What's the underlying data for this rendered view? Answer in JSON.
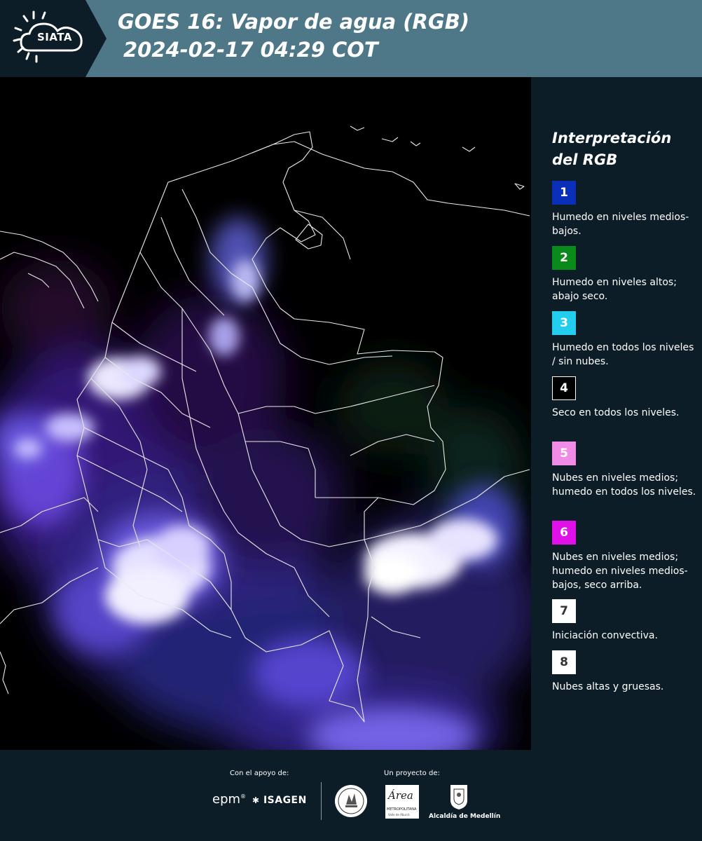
{
  "header": {
    "logo_text": "SIATA",
    "title_line1": "GOES 16: Vapor de agua (RGB)",
    "title_line2": "2024-02-17 04:29 COT"
  },
  "map": {
    "background_color": "#000000",
    "boundary_color": "#e8e8e8"
  },
  "legend": {
    "title": "Interpretación del RGB",
    "items": [
      {
        "number": "1",
        "color": "#0a2fb8",
        "text_color": "#ffffff",
        "description": "Humedo en niveles medios-bajos."
      },
      {
        "number": "2",
        "color": "#0a8a1a",
        "text_color": "#ffffff",
        "description": "Humedo en niveles altos; abajo seco."
      },
      {
        "number": "3",
        "color": "#22cdee",
        "text_color": "#ffffff",
        "description": "Humedo en todos los niveles / sin nubes."
      },
      {
        "number": "4",
        "color": "#000000",
        "text_color": "#ffffff",
        "description": "Seco en todos los niveles."
      },
      {
        "number": "5",
        "color": "#f08ce8",
        "text_color": "#ffffff",
        "description": "Nubes en niveles medios; humedo en todos los niveles."
      },
      {
        "number": "6",
        "color": "#e010e8",
        "text_color": "#ffffff",
        "description": "Nubes en niveles medios; humedo en niveles medios-bajos, seco arriba."
      },
      {
        "number": "7",
        "color": "#ffffff",
        "text_color": "#333333",
        "description": "Iniciación convectiva."
      },
      {
        "number": "8",
        "color": "#ffffff",
        "text_color": "#333333",
        "description": "Nubes altas y gruesas."
      }
    ]
  },
  "footer": {
    "support_label": "Con el apoyo de:",
    "project_label": "Un proyecto de:",
    "sponsor_epm": "epm",
    "sponsor_isagen": "ISAGEN",
    "area_metropolitana_caption": "METROPOLITANA",
    "area_metropolitana_sub": "Valle de Aburrá",
    "area_logo_text": "Área",
    "alcaldia_caption": "Alcaldía de Medellín"
  }
}
